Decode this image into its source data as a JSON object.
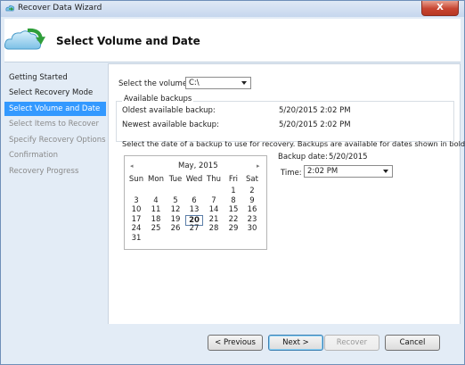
{
  "window": {
    "title": "Recover Data Wizard",
    "close_label": "X"
  },
  "header": {
    "title": "Select Volume and Date",
    "icon": "cloud-recover-icon"
  },
  "sidebar": {
    "items": [
      {
        "label": "Getting Started",
        "state": "normal"
      },
      {
        "label": "Select Recovery Mode",
        "state": "normal"
      },
      {
        "label": "Select Volume and Date",
        "state": "active"
      },
      {
        "label": "Select Items to Recover",
        "state": "disabled"
      },
      {
        "label": "Specify Recovery Options",
        "state": "disabled"
      },
      {
        "label": "Confirmation",
        "state": "disabled"
      },
      {
        "label": "Recovery Progress",
        "state": "disabled"
      }
    ]
  },
  "volume": {
    "label": "Select the volume:",
    "value": "C:\\"
  },
  "backups": {
    "group_title": "Available backups",
    "oldest_label": "Oldest available backup:",
    "oldest_value": "5/20/2015 2:02 PM",
    "newest_label": "Newest available backup:",
    "newest_value": "5/20/2015 2:02 PM"
  },
  "instruction": "Select the date of a backup to use for recovery. Backups are available for dates shown in bold.",
  "calendar": {
    "month": "May, 2015",
    "prev_icon": "◂",
    "next_icon": "▸",
    "weekdays": [
      "Sun",
      "Mon",
      "Tue",
      "Wed",
      "Thu",
      "Fri",
      "Sat"
    ],
    "weeks": [
      [
        "",
        "",
        "",
        "",
        "",
        "1",
        "2"
      ],
      [
        "3",
        "4",
        "5",
        "6",
        "7",
        "8",
        "9"
      ],
      [
        "10",
        "11",
        "12",
        "13",
        "14",
        "15",
        "16"
      ],
      [
        "17",
        "18",
        "19",
        "20",
        "21",
        "22",
        "23"
      ],
      [
        "24",
        "25",
        "26",
        "27",
        "28",
        "29",
        "30"
      ],
      [
        "31",
        "",
        "",
        "",
        "",
        "",
        ""
      ]
    ],
    "selected_day": "20"
  },
  "backup_date": {
    "label": "Backup date:",
    "value": "5/20/2015"
  },
  "time": {
    "label": "Time:",
    "value": "2:02 PM"
  },
  "buttons": {
    "previous": "< Previous",
    "next": "Next >",
    "recover": "Recover",
    "cancel": "Cancel"
  },
  "colors": {
    "selection": "#3399ff",
    "panel": "#e3ecf6"
  }
}
